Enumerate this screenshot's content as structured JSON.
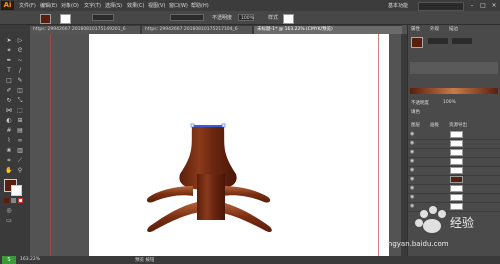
{
  "app": {
    "logo": "Ai"
  },
  "menu": [
    "文件(F)",
    "编辑(E)",
    "对象(O)",
    "文字(T)",
    "选择(S)",
    "效果(C)",
    "视图(V)",
    "窗口(W)",
    "帮助(H)"
  ],
  "workspace": "基本功能",
  "control": {
    "opacity_label": "不透明度",
    "opacity_value": "100%",
    "style_label": "样式"
  },
  "tabs": [
    {
      "label": "https: 29942667 20180810175149201_6"
    },
    {
      "label": "https: 29942667 20180810175217104_6"
    },
    {
      "label": "未标题-1* @ 163.22% (CMYK/预览)"
    }
  ],
  "panel": {
    "tabs": [
      "属性",
      "外观",
      "描边"
    ],
    "opacity_label": "不透明度",
    "opacity_value": "100%",
    "fill_label": "填色",
    "fill_color": "#5a1e0e",
    "layers_tabs": [
      "图层",
      "画板",
      "资源导出"
    ]
  },
  "colors": {
    "fill": "#5a1e0e",
    "stroke": "#ffffff",
    "wood_dark": "#5a1f0c",
    "wood_mid": "#8a3a1a",
    "wood_light": "#b5653a"
  },
  "statusbar": {
    "left": "预览 按钮",
    "zoom": "163.22%"
  },
  "watermark": {
    "brand": "Baidu",
    "text": "经验",
    "url": "jingyan.baidu.com"
  }
}
